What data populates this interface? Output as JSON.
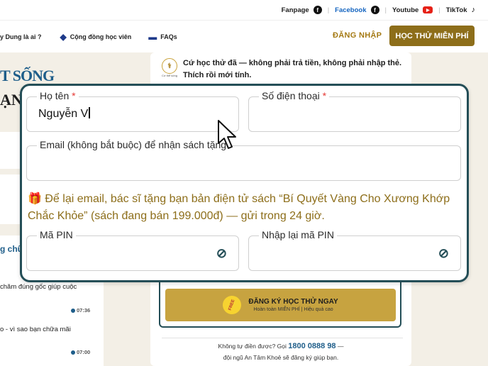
{
  "topbar": {
    "fanpage": "Fanpage",
    "facebook": "Facebook",
    "youtube": "Youtube",
    "tiktok": "TikTok"
  },
  "nav": {
    "item1": "y Dung là ai ?",
    "item2": "Cộng đồng học viên",
    "item3": "FAQs",
    "login": "ĐĂNG NHẬP",
    "trial": "HỌC THỬ MIỄN PHÍ"
  },
  "left": {
    "title1": "T SỐNG",
    "title2": "ẠN",
    "label": "g chữ",
    "row1": "chăm đúng gốc giúp cuộc",
    "time1": "07:36",
    "row2": "o - vì sao bạn chữa mãi",
    "time2": "07:00"
  },
  "card": {
    "logo_text": "Cơ thể sống",
    "intro": "Cứ học thử đã — không phải trả tiền, không phải nhập thẻ. Thích rồi mới tính.",
    "free_badge": "FREE",
    "register_title": "ĐĂNG KÝ HỌC THỬ NGAY",
    "register_sub": "Hoàn toàn MIỄN PHÍ | Hiệu quả cao",
    "help_prefix": "Không tự điền được? Gọi",
    "help_phone": "1800 0888 98",
    "help_suffix": "—",
    "help_line2": "đội ngũ An Tâm Khoẻ sẽ đăng ký giúp bạn."
  },
  "form": {
    "name_label": "Họ tên",
    "name_value": "Nguyễn V",
    "phone_label": "Số điện thoại",
    "required_mark": "*",
    "email_label": "Email (không bắt buộc) để nhận sách tặng",
    "gift_text": "Để lại email, bác sĩ tặng bạn bản điện tử sách “Bí Quyết Vàng Cho Xương Khớp Chắc Khỏe” (sách đang bán 199.000đ) — gửi trong 24 giờ.",
    "pin_label": "Mã PIN",
    "pin_confirm_label": "Nhập lại mã PIN"
  },
  "colors": {
    "accent_gold": "#8d6e1a",
    "teal_border": "#244e57",
    "link_blue": "#1565c0"
  }
}
